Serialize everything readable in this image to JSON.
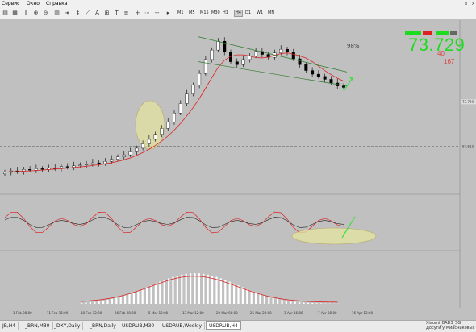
{
  "menu": {
    "service": "Сервис",
    "window": "Окно",
    "help": "Справка",
    "minimize": "_",
    "restore": "▫",
    "close": "x"
  },
  "timeframes": [
    {
      "label": "M1",
      "active": false
    },
    {
      "label": "M5",
      "active": false
    },
    {
      "label": "M15",
      "active": false
    },
    {
      "label": "M30",
      "active": false
    },
    {
      "label": "H1",
      "active": false
    },
    {
      "label": "H4",
      "active": true
    },
    {
      "label": "D1",
      "active": false
    },
    {
      "label": "W1",
      "active": false
    },
    {
      "label": "MN",
      "active": false
    }
  ],
  "info": {
    "price": "73.729",
    "swap_long": "40",
    "swap_short": "167",
    "percent": "98%",
    "colors": {
      "price": "#1ddc1d",
      "swap": "#e04040"
    }
  },
  "price_axis": [
    "73.729",
    "67.613"
  ],
  "date_axis": [
    "1 Feb 08:00",
    "11 Feb 16:00",
    "18 Feb 12:00",
    "26 Feb 08:00",
    "5 Mar 12:00",
    "13 Mar 12:00",
    "20 Mar 08:00",
    "26 Mar 20:00",
    "3 Apr 16:00",
    "7 Apr 08:00",
    "16 Apr 12:00"
  ],
  "tabs": [
    {
      "label": "JB,H4",
      "active": false
    },
    {
      "label": "_BRN,M30",
      "active": false
    },
    {
      "label": "_DXY,Daily",
      "active": false
    },
    {
      "label": "_BRN,Daily",
      "active": false
    },
    {
      "label": "USDRUB,M30",
      "active": false
    },
    {
      "label": "USDRUB,Weekly",
      "active": false
    },
    {
      "label": "USDRUB,H4",
      "active": true
    }
  ],
  "signature": {
    "line1": "Xiaomi_BAD3_SG",
    "line2": "Досуги у Миасниковых"
  },
  "chart_data": {
    "type": "candlestick",
    "symbol": "USDRUB",
    "timeframe": "H4",
    "close": [
      64.1,
      64.3,
      64.2,
      64.5,
      64.4,
      64.6,
      64.5,
      64.7,
      64.6,
      64.9,
      64.8,
      65.0,
      65.1,
      65.2,
      65.4,
      65.3,
      65.6,
      65.9,
      66.2,
      66.5,
      66.9,
      67.4,
      68.0,
      68.6,
      69.3,
      70.1,
      71.0,
      72.2,
      73.5,
      74.8,
      76.0,
      77.6,
      79.5,
      80.8,
      82.0,
      80.5,
      79.2,
      78.8,
      79.5,
      80.0,
      80.6,
      80.2,
      79.8,
      80.4,
      80.9,
      80.5,
      79.6,
      78.8,
      78.0,
      77.5,
      77.2,
      76.8,
      76.3,
      75.9,
      75.7
    ],
    "moving_average": "smooth red line following price",
    "lines": {
      "resistance_channel_upper": [
        [
          0,
          82.6
        ],
        [
          1,
          77.8
        ]
      ],
      "support_channel_lower": [
        [
          0,
          79.2
        ],
        [
          1,
          75.9
        ]
      ]
    },
    "horizontal_level": 67.613,
    "indicators": [
      {
        "name": "oscillator",
        "series": [
          "red",
          "black"
        ]
      },
      {
        "name": "histogram",
        "series": [
          "grey bars",
          "red signal"
        ]
      }
    ]
  }
}
